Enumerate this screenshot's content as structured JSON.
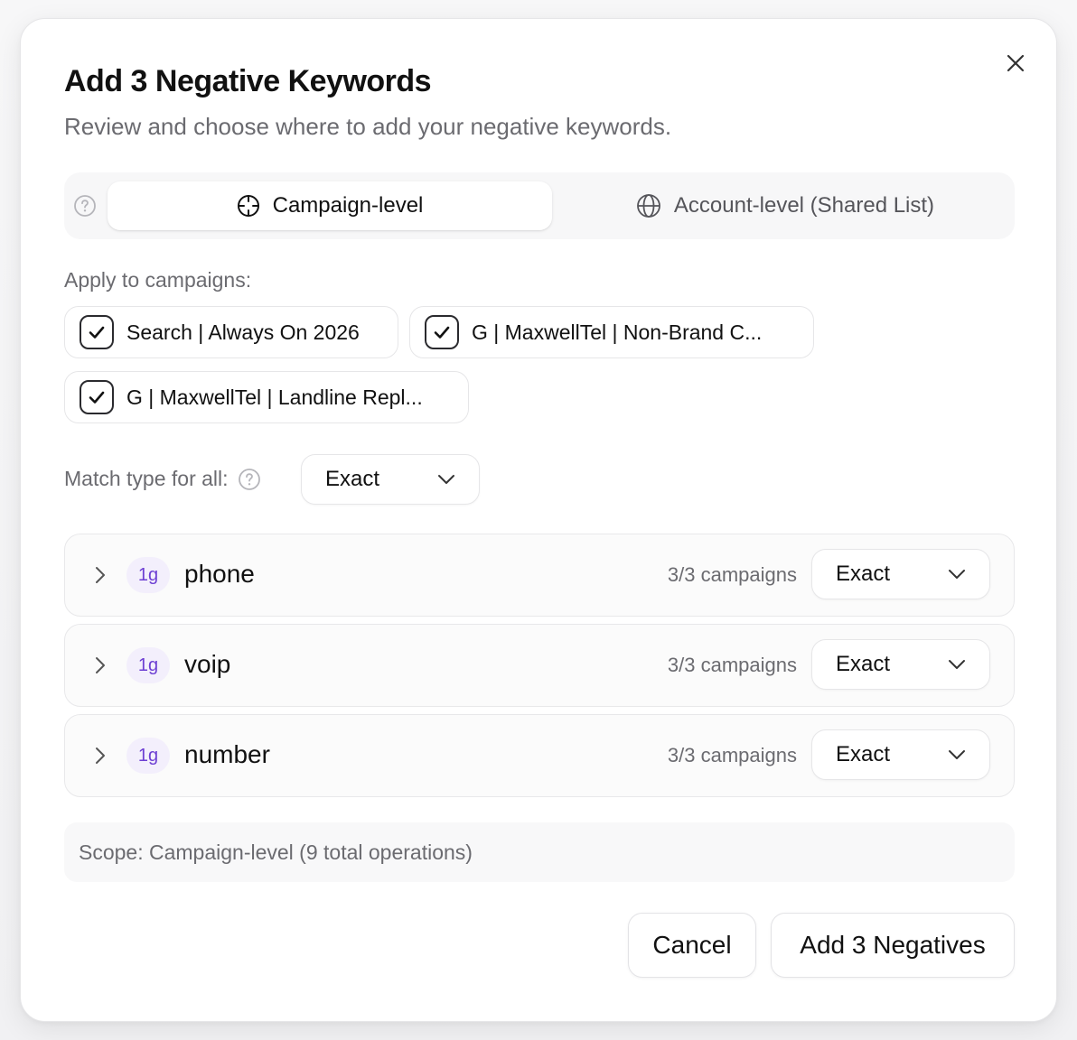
{
  "dialog": {
    "title": "Add 3 Negative Keywords",
    "subtitle": "Review and choose where to add your negative keywords.",
    "close_icon": "close-icon"
  },
  "scope_tabs": {
    "help_icon": "help-circle-icon",
    "items": [
      {
        "label": "Campaign-level",
        "icon": "crosshair-icon",
        "active": true
      },
      {
        "label": "Account-level (Shared List)",
        "icon": "globe-icon",
        "active": false
      }
    ]
  },
  "campaigns": {
    "label": "Apply to campaigns:",
    "items": [
      {
        "label": "Search | Always On 2026",
        "checked": true
      },
      {
        "label": "G | MaxwellTel | Non-Brand C...",
        "checked": true
      },
      {
        "label": "G | MaxwellTel | Landline Repl...",
        "checked": true
      }
    ]
  },
  "match_type": {
    "label": "Match type for all:",
    "value": "Exact"
  },
  "keywords": [
    {
      "ngram": "1g",
      "text": "phone",
      "count": "3/3 campaigns",
      "match": "Exact"
    },
    {
      "ngram": "1g",
      "text": "voip",
      "count": "3/3 campaigns",
      "match": "Exact"
    },
    {
      "ngram": "1g",
      "text": "number",
      "count": "3/3 campaigns",
      "match": "Exact"
    }
  ],
  "scope_note": "Scope: Campaign-level (9 total operations)",
  "footer": {
    "cancel_label": "Cancel",
    "submit_label": "Add 3 Negatives"
  },
  "colors": {
    "ngram_badge_bg": "#f3effc",
    "ngram_badge_text": "#6d3fd3"
  }
}
